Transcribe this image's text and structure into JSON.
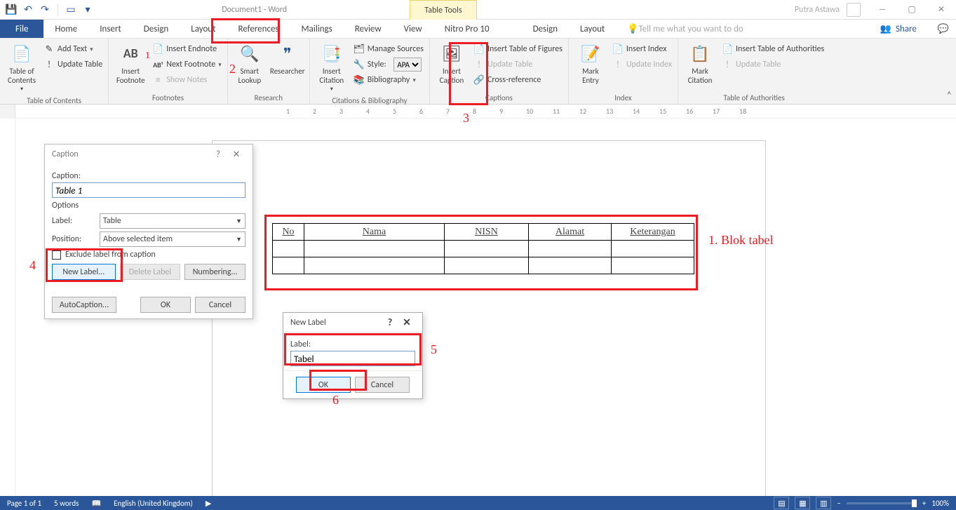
{
  "title": {
    "doc": "Document1 - Word",
    "tool_context": "Table Tools",
    "user": "Putra Astawa"
  },
  "tabs": {
    "file": "File",
    "home": "Home",
    "insert": "Insert",
    "design": "Design",
    "layout": "Layout",
    "references": "References",
    "mailings": "Mailings",
    "review": "Review",
    "view": "View",
    "nitro": "Nitro Pro 10",
    "ctx_design": "Design",
    "ctx_layout": "Layout",
    "tell": "Tell me what you want to do",
    "share": "Share"
  },
  "ribbon": {
    "toc": {
      "big": "Table of\nContents",
      "add_text": "Add Text",
      "update": "Update Table",
      "group": "Table of Contents"
    },
    "footnotes": {
      "big": "Insert\nFootnote",
      "ab": "AB",
      "endnote": "Insert Endnote",
      "next": "Next Footnote",
      "show": "Show Notes",
      "group": "Footnotes"
    },
    "research": {
      "smart": "Smart\nLookup",
      "researcher": "Researcher",
      "group": "Research"
    },
    "citations": {
      "big": "Insert\nCitation",
      "manage": "Manage Sources",
      "style_lbl": "Style:",
      "style_val": "APA",
      "bib": "Bibliography",
      "group": "Citations & Bibliography"
    },
    "captions": {
      "big": "Insert\nCaption",
      "tof": "Insert Table of Figures",
      "update": "Update Table",
      "cross": "Cross-reference",
      "group": "Captions"
    },
    "index": {
      "big": "Mark\nEntry",
      "insert": "Insert Index",
      "update": "Update Index",
      "group": "Index"
    },
    "citation2": {
      "big": "Mark\nCitation",
      "group_lbl": ""
    },
    "toa": {
      "insert": "Insert Table of Authorities",
      "update": "Update Table",
      "group": "Table of Authorities"
    }
  },
  "caption_dialog": {
    "title": "Caption",
    "caption_lbl": "Caption:",
    "caption_val": "Table 1",
    "options": "Options",
    "label_lbl": "Label:",
    "label_val": "Table",
    "position_lbl": "Position:",
    "position_val": "Above selected item",
    "exclude": "Exclude label from caption",
    "new_label": "New Label...",
    "delete_label": "Delete Label",
    "numbering": "Numbering...",
    "autocaption": "AutoCaption...",
    "ok": "OK",
    "cancel": "Cancel"
  },
  "newlabel_dialog": {
    "title": "New Label",
    "label_lbl": "Label:",
    "value": "Tabel",
    "ok": "OK",
    "cancel": "Cancel"
  },
  "table": {
    "h1": "No",
    "h2": "Nama",
    "h3": "NISN",
    "h4": "Alamat",
    "h5": "Keterangan"
  },
  "annotations": {
    "a1": "1. Blok tabel",
    "a2": "2",
    "a3": "3",
    "a4": "4",
    "a5": "5",
    "a6": "6",
    "ab1": "1"
  },
  "status": {
    "page": "Page 1 of 1",
    "words": "5 words",
    "lang": "English (United Kingdom)",
    "zoom": "100%",
    "minus": "−",
    "plus": "+"
  }
}
